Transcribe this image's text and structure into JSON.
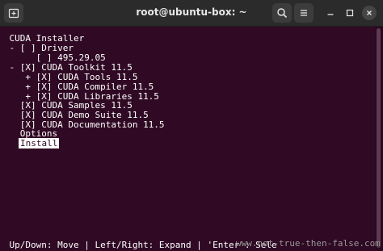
{
  "titlebar": {
    "title": "root@ubuntu-box: ~",
    "new_tab_icon": "new-tab-icon",
    "search_icon": "search-icon",
    "menu_icon": "hamburger-menu-icon"
  },
  "terminal": {
    "lines": [
      "CUDA Installer",
      "- [ ] Driver",
      "     [ ] 495.29.05",
      "- [X] CUDA Toolkit 11.5",
      "   + [X] CUDA Tools 11.5",
      "   + [X] CUDA Compiler 11.5",
      "   + [X] CUDA Libraries 11.5",
      "  [X] CUDA Samples 11.5",
      "  [X] CUDA Demo Suite 11.5",
      "  [X] CUDA Documentation 11.5",
      "  Options",
      "Install",
      "Up/Down: Move | Left/Right: Expand | 'Enter': Sele"
    ]
  },
  "watermark": "www.not-true-then-false.com",
  "colors": {
    "terminal_bg": "#300a24",
    "terminal_fg": "#ffffff",
    "titlebar_bg": "#2b2b2b"
  }
}
